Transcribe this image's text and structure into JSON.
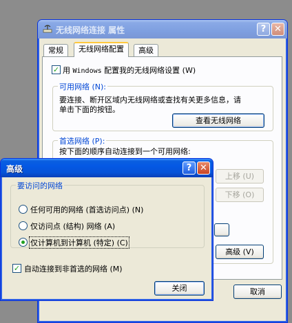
{
  "desktop": {
    "background": "#8c8c8c"
  },
  "main_window": {
    "title": "无线网络连接 属性",
    "help_label": "?",
    "close_label": "✕",
    "tabs": [
      {
        "label": "常规"
      },
      {
        "label": "无线网络配置"
      },
      {
        "label": "高级"
      }
    ],
    "use_windows": {
      "checked": true,
      "label_pre": "用",
      "label_mono": "Windows",
      "label_post": "配置我的无线网络设置 (W)"
    },
    "available": {
      "legend": "可用网络 (N):",
      "description_line1": "要连接、断开区域内无线网络或查找有关更多信息，请",
      "description_line2": "单击下面的按钮。",
      "view_button": "查看无线网络"
    },
    "preferred": {
      "legend": "首选网络 (P):",
      "description": "按下面的顺序自动连接到一个可用网络:",
      "move_up": "上移 (U)",
      "move_down": "下移 (O)",
      "advanced_button": "高级 (V)"
    },
    "cancel_button": "取消"
  },
  "advanced_dialog": {
    "title": "高级",
    "help_label": "?",
    "close_label": "✕",
    "group_legend": "要访问的网络",
    "options": [
      {
        "label": "任何可用的网络 (首选访问点) (N)",
        "selected": false
      },
      {
        "label": "仅访问点 (结构) 网络 (A)",
        "selected": false
      },
      {
        "label": "仅计算机到计算机 (特定) (C)",
        "selected": true
      }
    ],
    "auto_connect": {
      "checked": true,
      "label": "自动连接到非首选的网络 (M)"
    },
    "close_button": "关闭"
  }
}
